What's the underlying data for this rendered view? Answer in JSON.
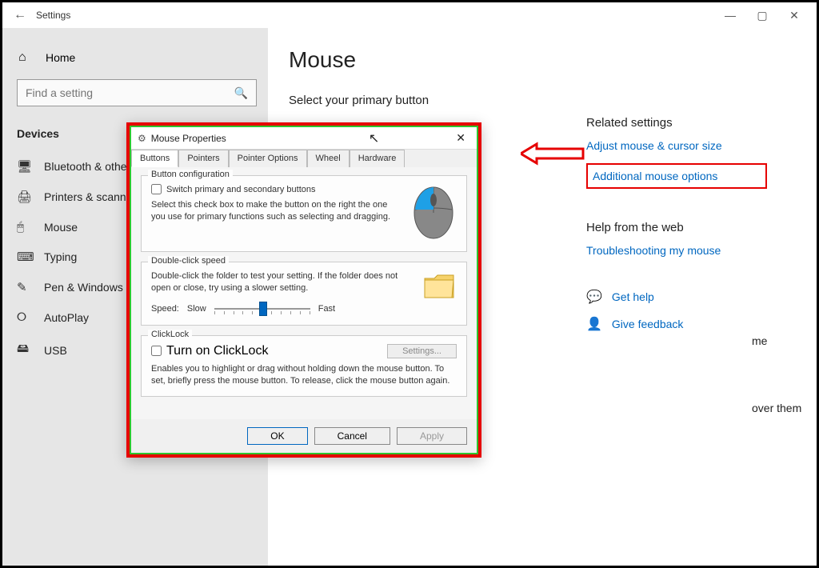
{
  "window": {
    "title": "Settings",
    "buttons": {
      "min": "—",
      "max": "▢",
      "close": "✕"
    }
  },
  "sidebar": {
    "home": "Home",
    "search_placeholder": "Find a setting",
    "section": "Devices",
    "items": [
      {
        "icon": "🖥",
        "label": "Bluetooth & other devices"
      },
      {
        "icon": "🖨",
        "label": "Printers & scanners"
      },
      {
        "icon": "🖱",
        "label": "Mouse"
      },
      {
        "icon": "⌨",
        "label": "Typing"
      },
      {
        "icon": "✎",
        "label": "Pen & Windows Ink"
      },
      {
        "icon": "⭘",
        "label": "AutoPlay"
      },
      {
        "icon": "🖴",
        "label": "USB"
      }
    ]
  },
  "main": {
    "title": "Mouse",
    "primary_label": "Select your primary button",
    "peek1": "me",
    "peek2": "over them"
  },
  "related": {
    "heading": "Related settings",
    "adjust": "Adjust mouse & cursor size",
    "additional": "Additional mouse options",
    "help_heading": "Help from the web",
    "troubleshoot": "Troubleshooting my mouse",
    "get_help": "Get help",
    "give_feedback": "Give feedback"
  },
  "dialog": {
    "title": "Mouse Properties",
    "tabs": [
      "Buttons",
      "Pointers",
      "Pointer Options",
      "Wheel",
      "Hardware"
    ],
    "group1": {
      "legend": "Button configuration",
      "checkbox": "Switch primary and secondary buttons",
      "desc": "Select this check box to make the button on the right the one you use for primary functions such as selecting and dragging."
    },
    "group2": {
      "legend": "Double-click speed",
      "desc": "Double-click the folder to test your setting. If the folder does not open or close, try using a slower setting.",
      "speed_label": "Speed:",
      "slow": "Slow",
      "fast": "Fast"
    },
    "group3": {
      "legend": "ClickLock",
      "checkbox": "Turn on ClickLock",
      "settings_btn": "Settings...",
      "desc": "Enables you to highlight or drag without holding down the mouse button. To set, briefly press the mouse button. To release, click the mouse button again."
    },
    "buttons": {
      "ok": "OK",
      "cancel": "Cancel",
      "apply": "Apply"
    }
  }
}
